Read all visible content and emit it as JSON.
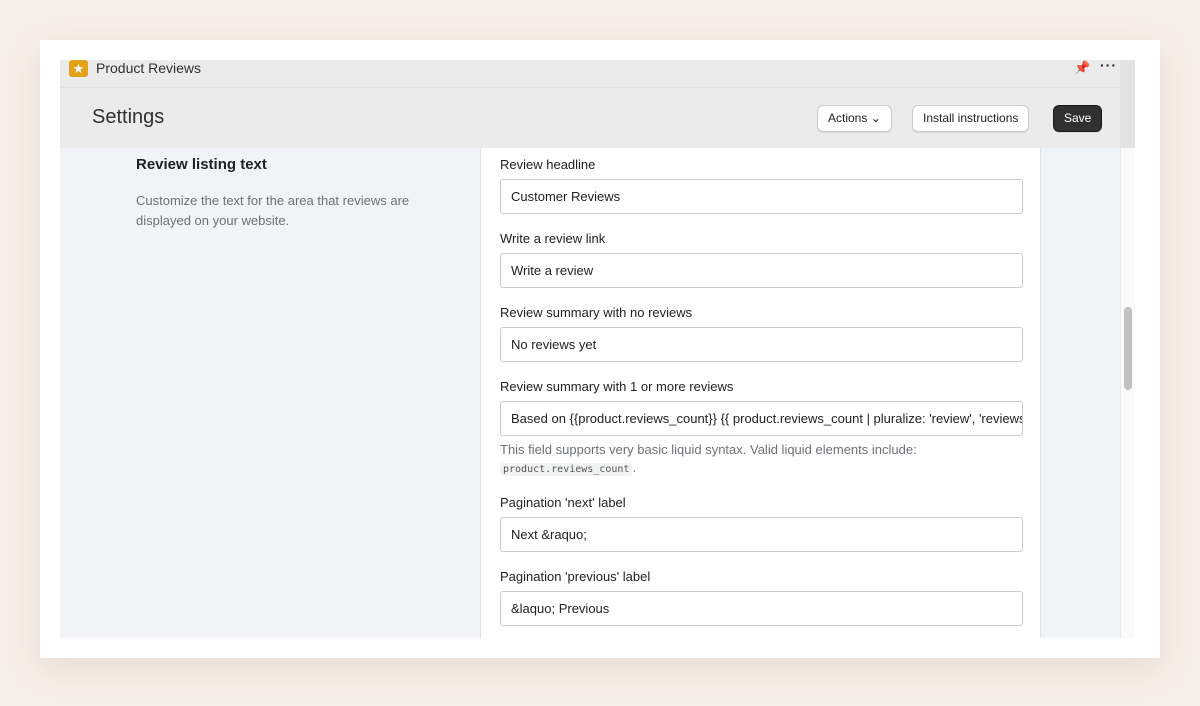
{
  "app": {
    "title": "Product Reviews",
    "logo_icon": "star-icon"
  },
  "header": {
    "title": "Settings",
    "actions_label": "Actions",
    "install_label": "Install instructions",
    "save_label": "Save"
  },
  "section": {
    "title": "Review listing text",
    "description": "Customize the text for the area that reviews are displayed on your website."
  },
  "fields": [
    {
      "label": "Review headline",
      "value": "Customer Reviews"
    },
    {
      "label": "Write a review link",
      "value": "Write a review"
    },
    {
      "label": "Review summary with no reviews",
      "value": "No reviews yet"
    },
    {
      "label": "Review summary with 1 or more reviews",
      "value": "Based on {{product.reviews_count}} {{ product.reviews_count | pluralize: 'review', 'reviews' }}",
      "help": "This field supports very basic liquid syntax. Valid liquid elements include:",
      "help_code": "product.reviews_count",
      "help_end": "."
    },
    {
      "label": "Pagination 'next' label",
      "value": "Next &raquo;"
    },
    {
      "label": "Pagination 'previous' label",
      "value": "&laquo; Previous"
    }
  ]
}
